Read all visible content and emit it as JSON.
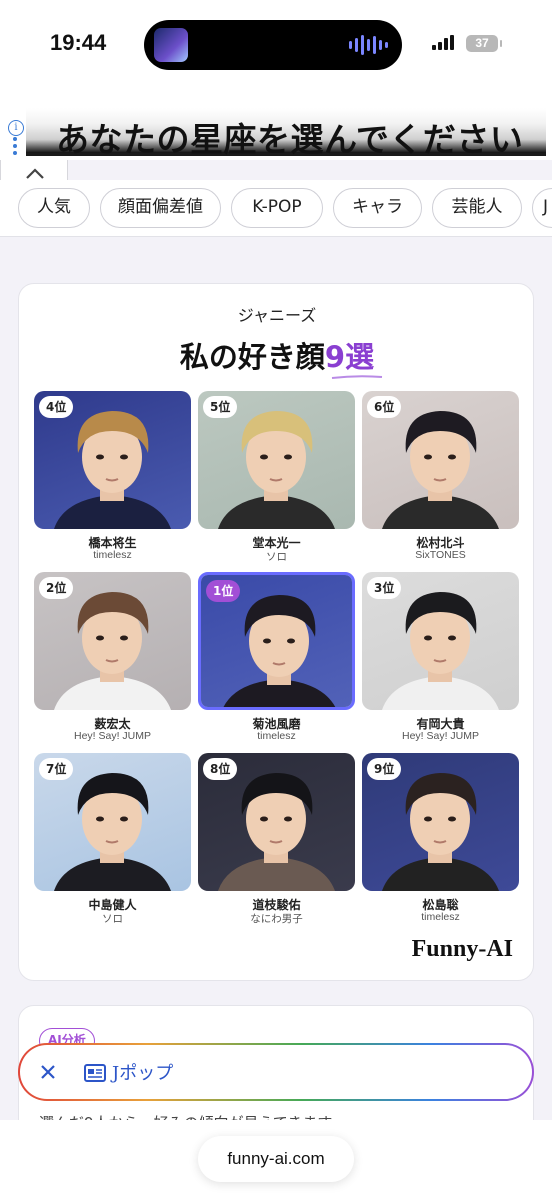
{
  "status_bar": {
    "time": "19:44",
    "battery": "37"
  },
  "ad": {
    "headline": "あなたの星座を選んでください"
  },
  "categories": [
    "人気",
    "顔面偏差値",
    "K-POP",
    "キャラ",
    "芸能人",
    "J"
  ],
  "card": {
    "subtitle": "ジャニーズ",
    "title_main": "私の好き顔",
    "title_accent": "9選",
    "tiles": [
      {
        "rank": "4位",
        "name": "橋本将生",
        "group": "timelesz"
      },
      {
        "rank": "5位",
        "name": "堂本光一",
        "group": "ソロ"
      },
      {
        "rank": "6位",
        "name": "松村北斗",
        "group": "SixTONES"
      },
      {
        "rank": "2位",
        "name": "薮宏太",
        "group": "Hey! Say! JUMP"
      },
      {
        "rank": "1位",
        "name": "菊池風磨",
        "group": "timelesz"
      },
      {
        "rank": "3位",
        "name": "有岡大貴",
        "group": "Hey! Say! JUMP"
      },
      {
        "rank": "7位",
        "name": "中島健人",
        "group": "ソロ"
      },
      {
        "rank": "8位",
        "name": "道枝駿佑",
        "group": "なにわ男子"
      },
      {
        "rank": "9位",
        "name": "松島聡",
        "group": "timelesz"
      }
    ],
    "watermark": "Funny-AI"
  },
  "card2": {
    "badge": "AI分析",
    "text": "選んだ9人から、好みの傾向が見えてきます"
  },
  "search": {
    "query": "Jポップ"
  },
  "bottom": {
    "url": "funny-ai.com"
  },
  "colors": {
    "accent": "#8a3fd1",
    "rank_first": "#a24fd6",
    "highlight_border": "#6a6cff"
  }
}
